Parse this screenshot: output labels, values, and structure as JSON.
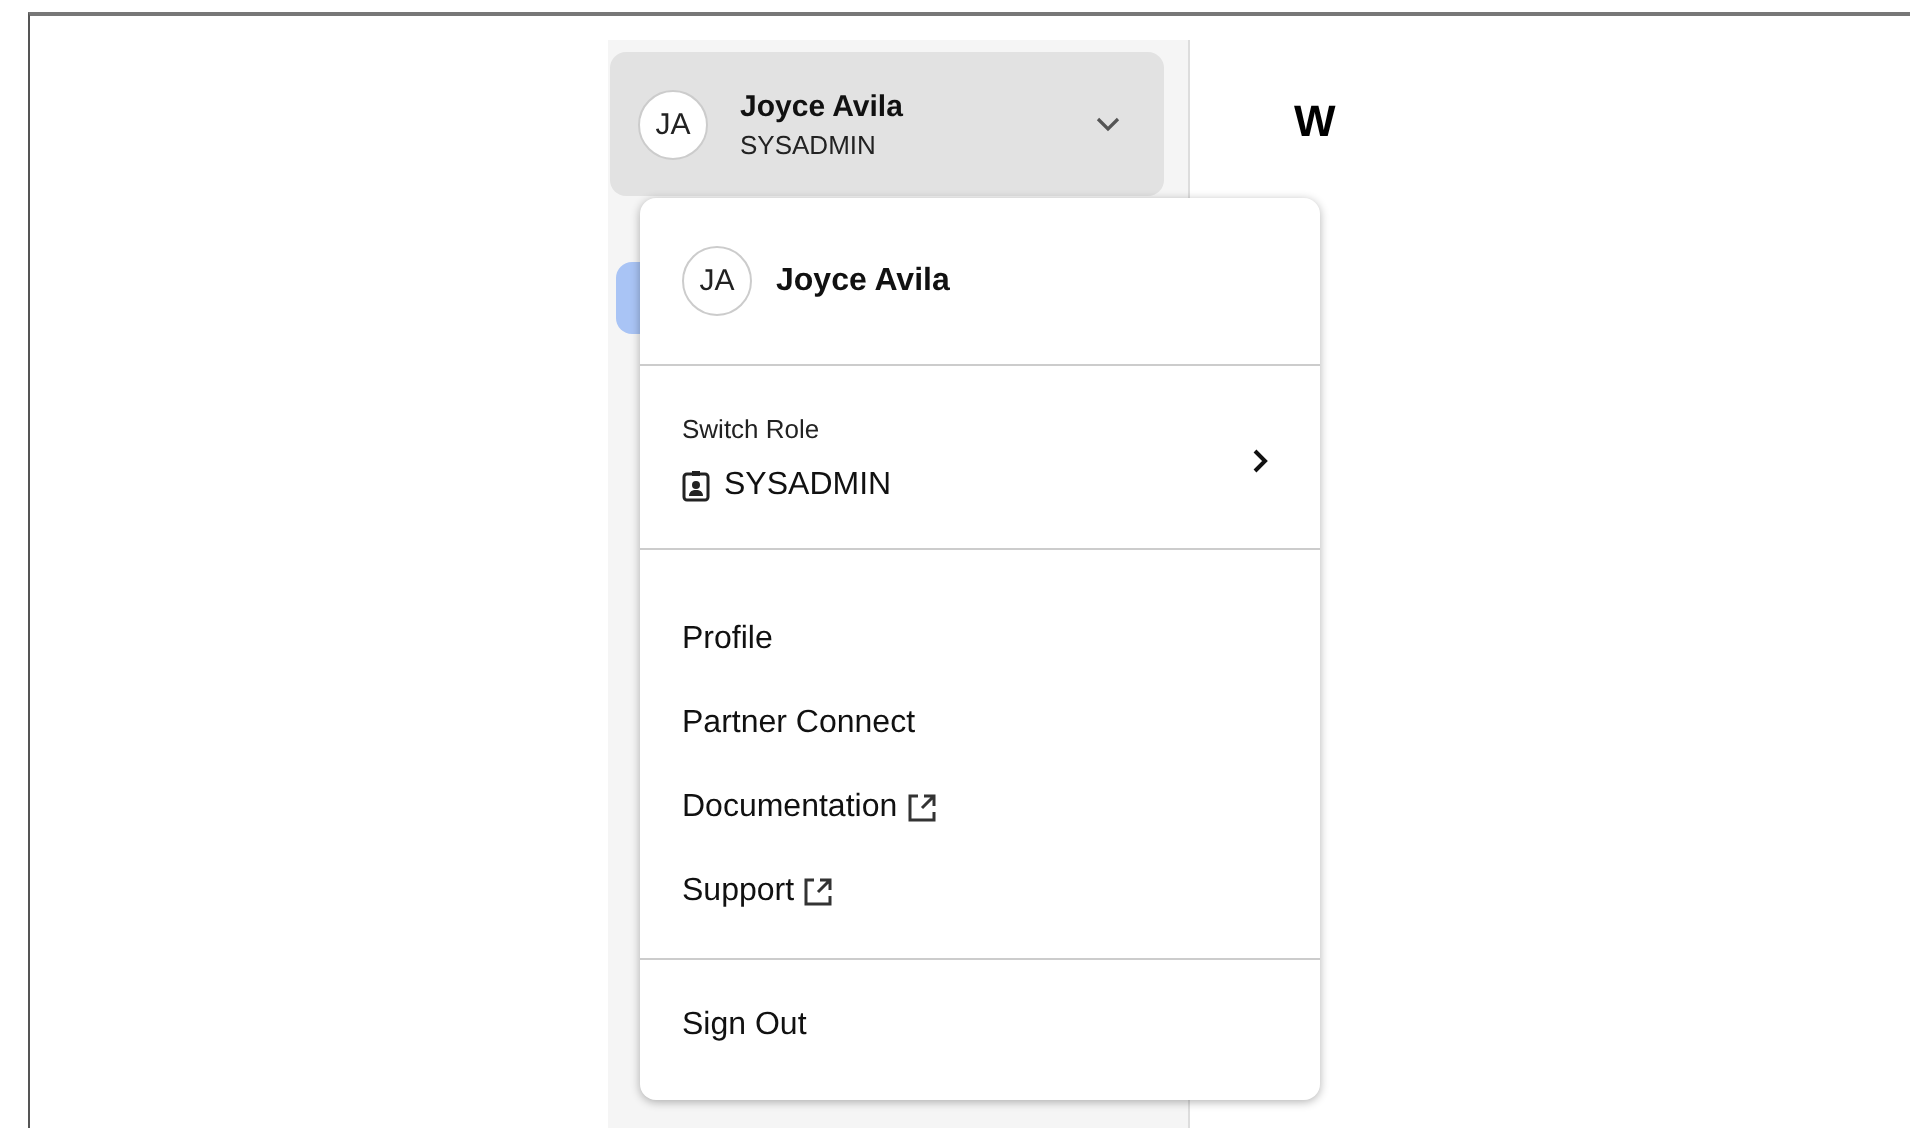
{
  "user_button": {
    "initials": "JA",
    "name": "Joyce Avila",
    "role": "SYSADMIN",
    "expanded": true
  },
  "page_heading": "W",
  "menu": {
    "header": {
      "initials": "JA",
      "name": "Joyce Avila"
    },
    "switch_role": {
      "label": "Switch Role",
      "role": "SYSADMIN"
    },
    "items": [
      {
        "label": "Profile",
        "external": false
      },
      {
        "label": "Partner Connect",
        "external": false
      },
      {
        "label": "Documentation",
        "external": true
      },
      {
        "label": "Support",
        "external": true
      }
    ],
    "sign_out": "Sign Out"
  }
}
